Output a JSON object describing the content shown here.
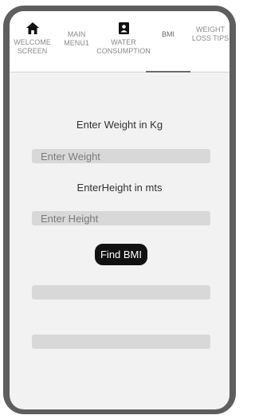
{
  "tabs": [
    {
      "label": "WELCOME SCREEN",
      "icon": "home-icon"
    },
    {
      "label": "MAIN MENU1",
      "icon": ""
    },
    {
      "label": "WATER CONSUMPTION",
      "icon": "contact-card-icon"
    },
    {
      "label": "BMI",
      "icon": "",
      "active": true
    },
    {
      "label": "WEIGHT LOSS TIPS",
      "icon": ""
    }
  ],
  "form": {
    "weight_prompt": "Enter Weight in Kg",
    "weight_placeholder": "Enter Weight",
    "weight_value": "",
    "height_prompt": "EnterHeight in mts",
    "height_placeholder": "Enter Height",
    "height_value": "",
    "find_label": "Find BMI"
  },
  "results": {
    "bmi_value": "",
    "bmi_category": ""
  },
  "colors": {
    "frame": "#5e5e5e",
    "screen_bg": "#f2f2f2",
    "field_bg": "#d8d8d8",
    "button_bg": "#111111"
  }
}
